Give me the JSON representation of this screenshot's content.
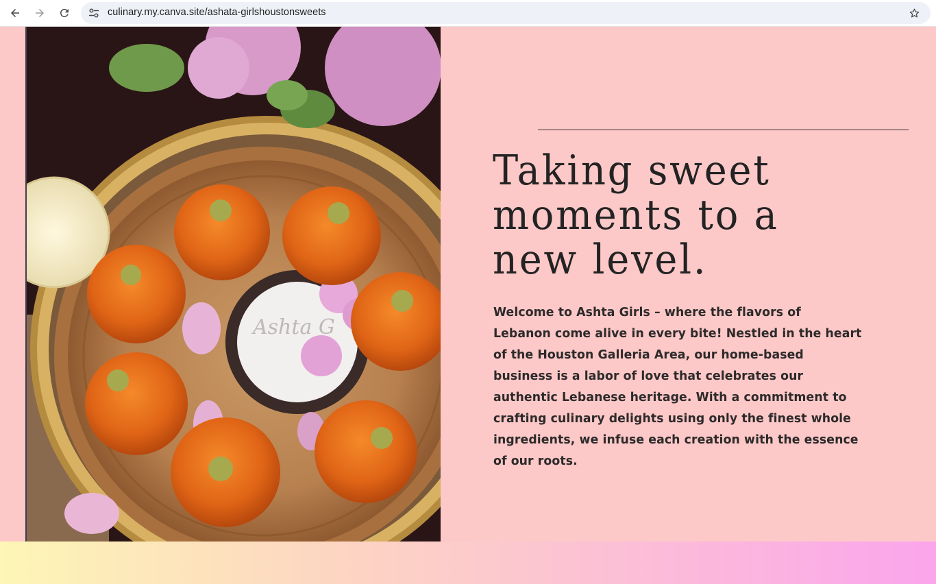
{
  "browser": {
    "url": "culinary.my.canva.site/ashata-girlshoustonsweets",
    "icons": {
      "back": "arrow-left-icon",
      "forward": "arrow-right-icon",
      "reload": "reload-icon",
      "site_info": "tune-icon",
      "bookmark": "star-icon"
    }
  },
  "hero": {
    "headline": "Taking sweet moments to a new level.",
    "intro": "Welcome to Ashta Girls – where the flavors of Lebanon come alive in every bite! Nestled in the heart of the Houston Galleria Area, our home-based business is a labor of love that celebrates our authentic Lebanese heritage. With a commitment to crafting culinary delights using only the finest whole ingredients, we infuse each creation with the essence of our roots."
  },
  "colors": {
    "page_background": "#fdc8c8",
    "text": "#232323",
    "gradient_start": "#fdf6b6",
    "gradient_end": "#fba5ec"
  }
}
